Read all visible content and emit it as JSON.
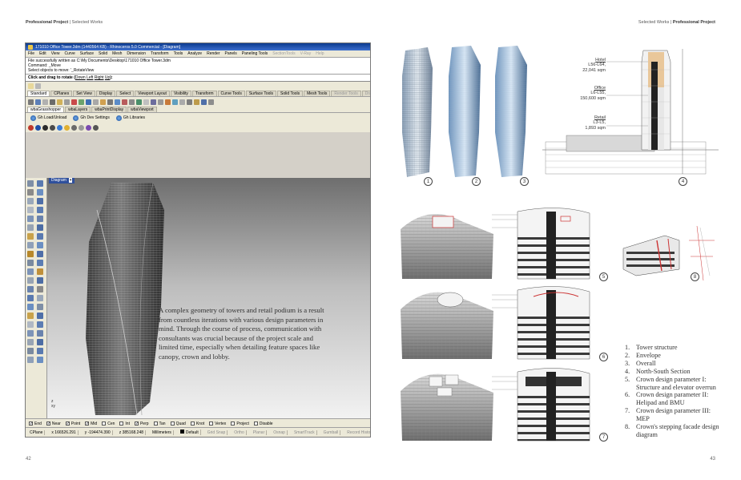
{
  "header": {
    "left_bold": "Professional Project",
    "left_rest": " | Selected Works",
    "right_rest": "Selected Works | ",
    "right_bold": "Professional Project"
  },
  "page_numbers": {
    "left": "42",
    "right": "43"
  },
  "rhino": {
    "title": "171010 Office Tower.3dm (1440564 KB) - Rhinoceros 5.0 Commercial - [Diagram]",
    "menu": [
      "File",
      "Edit",
      "View",
      "Curve",
      "Surface",
      "Solid",
      "Mesh",
      "Dimension",
      "Transform",
      "Tools",
      "Analyze",
      "Render",
      "Panels",
      "Paneling Tools",
      "SectionTools",
      "V-Ray",
      "Help"
    ],
    "command_lines": [
      "File successfully written as C:\\My Documents\\Desktop\\171010 Office Tower.3dm",
      "Command: _Move",
      "Select objects to move: '_RotateView"
    ],
    "prompt": {
      "text": "Click and drag to rotate (",
      "opt1": "Down",
      "opt2": "Left",
      "opt3": "Right",
      "opt4": "Up",
      "end": " ):"
    },
    "toolbar_tabs": [
      "Standard",
      "CPlanes",
      "Set View",
      "Display",
      "Select",
      "Viewport Layout",
      "Visibility",
      "Transform",
      "Curve Tools",
      "Surface Tools",
      "Solid Tools",
      "Mesh Tools",
      "Render Tools",
      "Drafting",
      "New in V5"
    ],
    "gh_tabs": [
      "wbaGrasshopper",
      "wbaLayers",
      "wbaPrintDisplay",
      "wbaViewport"
    ],
    "gh_buttons": [
      "Gh Load/Unload",
      "Gh Dev Settings",
      "Gh Libraries"
    ],
    "viewport_label": "Diagram",
    "osnaps": [
      {
        "label": "End",
        "on": true
      },
      {
        "label": "Near",
        "on": true
      },
      {
        "label": "Point",
        "on": true
      },
      {
        "label": "Mid",
        "on": true
      },
      {
        "label": "Cen",
        "on": false
      },
      {
        "label": "Int",
        "on": false
      },
      {
        "label": "Perp",
        "on": true
      },
      {
        "label": "Tan",
        "on": false
      },
      {
        "label": "Quad",
        "on": false
      },
      {
        "label": "Knot",
        "on": false
      },
      {
        "label": "Vertex",
        "on": false
      },
      {
        "label": "Project",
        "on": false
      },
      {
        "label": "Disable",
        "on": false
      }
    ],
    "status": {
      "cplane": "CPlane",
      "x": "x 166526.291",
      "y": "y -194474.390",
      "z": "z 385168.248",
      "units": "Millimeters",
      "layer": "Default",
      "panes": [
        "Grid Snap",
        "Ortho",
        "Planar",
        "Osnap",
        "SmartTrack",
        "Gumball",
        "Record History",
        "Filter"
      ]
    }
  },
  "caption": "A complex geometry of towers and retail podium is a result from countless iterations with various design parameters in mind. Through the course of process, communication with consultants was crucial because of the project scale and limited time, especially when detailing feature spaces like canopy, crown and lobby.",
  "section_labels": [
    {
      "head": "Hotel",
      "lines": [
        "L56-L64,",
        "22,041 sqm"
      ]
    },
    {
      "head": "Office",
      "lines": [
        "L6-L55,",
        "150,600 sqm"
      ]
    },
    {
      "head": "Retail",
      "lines": [
        "L3-L5,",
        "1,893 sqm"
      ]
    }
  ],
  "figure_numbers": [
    "1",
    "2",
    "3",
    "4",
    "5",
    "6",
    "7",
    "8"
  ],
  "legend": [
    {
      "n": "1.",
      "text": "Tower structure"
    },
    {
      "n": "2.",
      "text": "Envelope"
    },
    {
      "n": "3.",
      "text": "Overall"
    },
    {
      "n": "4.",
      "text": "North-South Section"
    },
    {
      "n": "5.",
      "text": "Crown design parameter I: Structure and elevator overrun"
    },
    {
      "n": "6.",
      "text": "Crown design parameter II: Helipad and BMU"
    },
    {
      "n": "7.",
      "text": "Crown design parameter III: MEP"
    },
    {
      "n": "8.",
      "text": "Crown's stepping facade design diagram"
    }
  ]
}
